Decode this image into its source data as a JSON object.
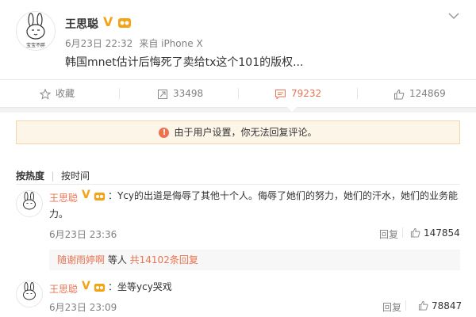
{
  "post": {
    "username": "王思聪",
    "time": "6月23日 22:32",
    "source": "来自 iPhone X",
    "text": "韩国mnet估计后悔死了卖给tx这个101的版权...",
    "avatar_caption": "宝宝不胖"
  },
  "actions": {
    "collect": "收藏",
    "repost": "33498",
    "comment": "79232",
    "like": "124869"
  },
  "notice": "由于用户设置，你无法回复评论。",
  "sort_tabs": {
    "hot": "按热度",
    "time": "按时间"
  },
  "comments": [
    {
      "username": "王思聪",
      "text_line1": "：Ycy的出道是侮辱了其他十个人。侮辱了她们的努力，她们的汗水，她们的业务能",
      "text_line2": "力。",
      "time": "6月23日 23:36",
      "reply": "回复",
      "likes": "147854",
      "sub_reply": {
        "name": "随谢雨婷啊",
        "mid": " 等人 ",
        "count": "共14102条回复"
      }
    },
    {
      "username": "王思聪",
      "text_line1": "：坐等ycy哭戏",
      "time": "6月23日 23:09",
      "reply": "回复",
      "likes": "78847"
    }
  ],
  "colors": {
    "accent": "#eb7350",
    "vip": "#f4a315",
    "notice_bg": "#fdf5e8"
  },
  "icons": [
    "star-icon",
    "repost-icon",
    "comment-icon",
    "thumbs-up-icon",
    "chevron-down-icon",
    "warning-icon",
    "verified-v-icon",
    "fan-badge-icon"
  ]
}
